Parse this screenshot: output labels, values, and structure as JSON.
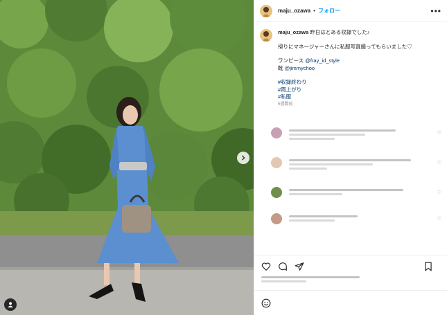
{
  "header": {
    "username": "maju_ozawa",
    "separator": "•",
    "follow_label": "フォロー",
    "more_label": "•••"
  },
  "caption": {
    "username": "maju_ozawa",
    "line1": "昨日はとある収録でした♪",
    "line2": "帰りにマネージャーさんに私服写真撮ってもらいました♡",
    "dress_prefix": "ワンピース ",
    "dress_link": "@fray_id_style",
    "shoes_prefix": "靴 ",
    "shoes_link": "@jimmychoo",
    "tags": [
      "#収録終わり",
      "#雨上がり",
      "#私服"
    ],
    "time": "5週間前"
  },
  "add_comment": {
    "placeholder": "",
    "post_label": ""
  },
  "colors": {
    "accent": "#0095f6",
    "link": "#00376b",
    "dress": "#5b8fd0",
    "foliage": "#4f7a33"
  },
  "icons": {
    "header_more": "more-icon",
    "next": "chevron-right-icon",
    "tag": "user-tag-icon",
    "like": "heart-icon",
    "comment": "comment-icon",
    "share": "share-icon",
    "save": "bookmark-icon",
    "emoji": "emoji-icon"
  }
}
